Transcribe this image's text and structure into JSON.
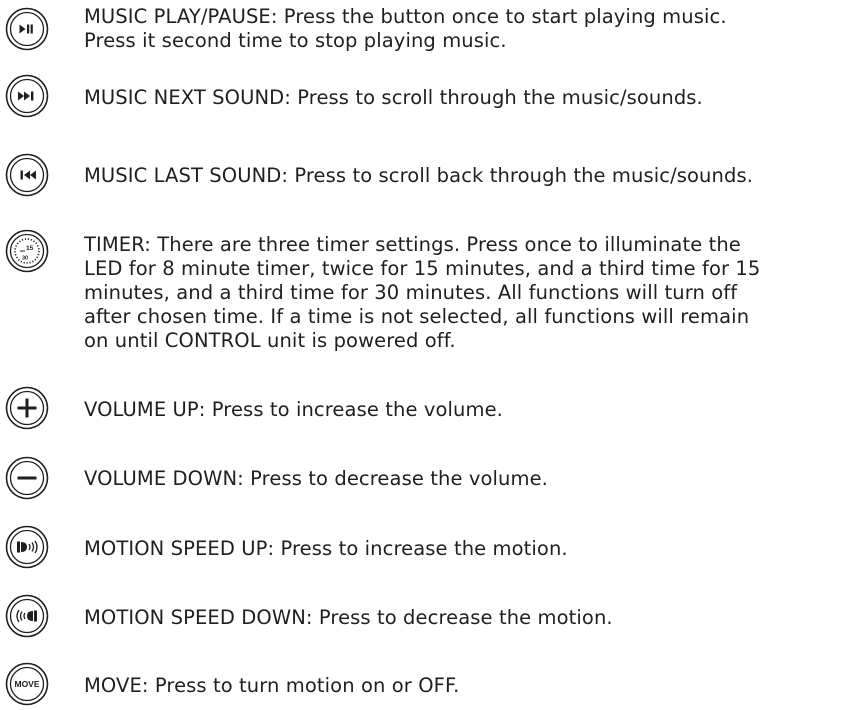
{
  "items": [
    {
      "icon": "play-pause-icon",
      "lines": [
        "MUSIC PLAY/PAUSE: Press the button once to start playing music.",
        "Press it second time to stop playing music."
      ]
    },
    {
      "icon": "next-track-icon",
      "lines": [
        "MUSIC NEXT SOUND:  Press to scroll through the music/sounds."
      ]
    },
    {
      "icon": "previous-track-icon",
      "lines": [
        "MUSIC LAST SOUND: Press to scroll back through the music/sounds."
      ]
    },
    {
      "icon": "timer-icon",
      "icon_text": [
        "15",
        "30"
      ],
      "lines": [
        "TIMER: There are three timer settings. Press once to illuminate the",
        "LED for 8 minute timer, twice for 15 minutes, and a third time for 15",
        "minutes, and a third time for 30 minutes. All functions will turn off",
        "after chosen time. If a time is not selected, all functions will remain",
        "on until CONTROL unit is powered off."
      ]
    },
    {
      "icon": "plus-icon",
      "lines": [
        "VOLUME UP: Press to increase the volume."
      ]
    },
    {
      "icon": "minus-icon",
      "lines": [
        "VOLUME DOWN: Press to decrease the volume."
      ]
    },
    {
      "icon": "motion-speed-up-icon",
      "lines": [
        "MOTION SPEED UP: Press to increase the motion."
      ]
    },
    {
      "icon": "motion-speed-down-icon",
      "lines": [
        "MOTION SPEED DOWN: Press to decrease the motion."
      ]
    },
    {
      "icon": "move-icon",
      "icon_text": [
        "MOVE"
      ],
      "lines": [
        "MOVE: Press to turn motion on or OFF."
      ]
    }
  ]
}
